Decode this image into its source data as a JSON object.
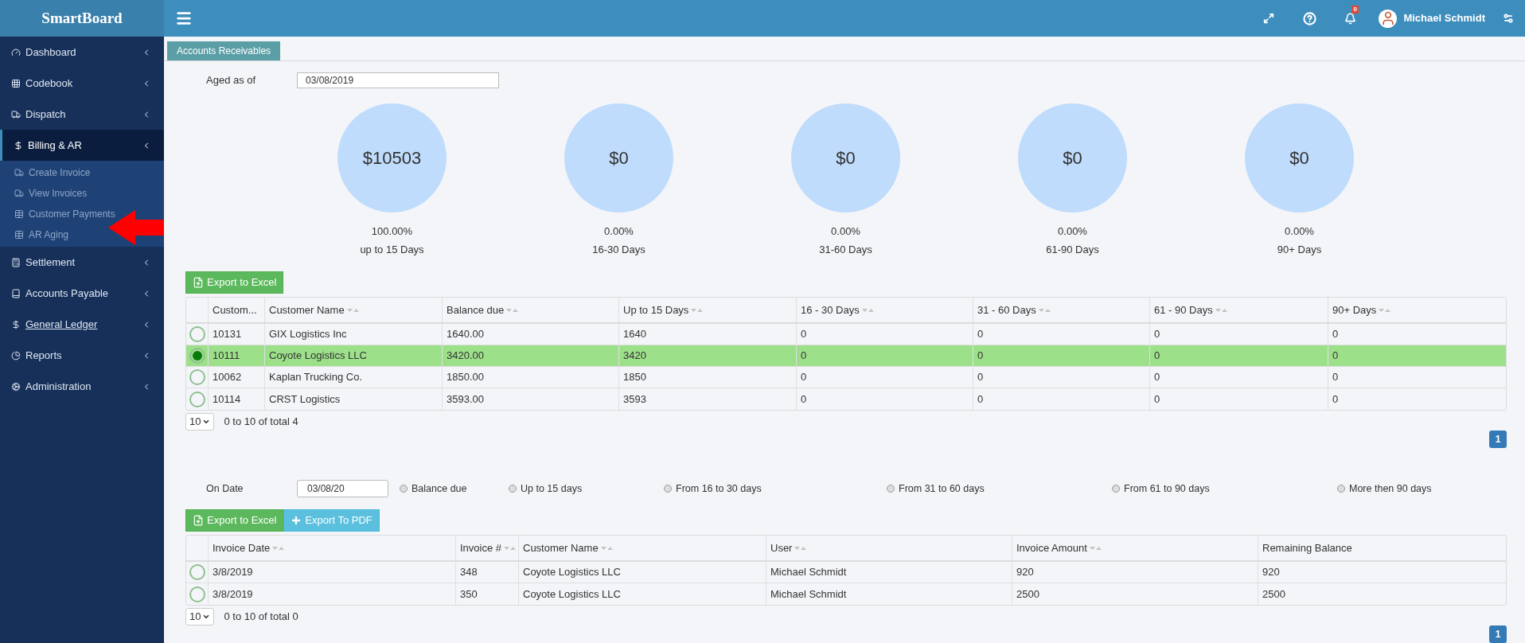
{
  "app": {
    "logo": "SmartBoard"
  },
  "header": {
    "user": "Michael Schmidt",
    "notifications": "0"
  },
  "sidebar": {
    "items": [
      {
        "label": "Dashboard",
        "expanded": false,
        "hovered": false
      },
      {
        "label": "Codebook",
        "expanded": false,
        "hovered": false
      },
      {
        "label": "Dispatch",
        "expanded": false,
        "hovered": false
      },
      {
        "label": "Billing & AR",
        "expanded": true,
        "hovered": false,
        "children": [
          {
            "label": "Create Invoice"
          },
          {
            "label": "View Invoices"
          },
          {
            "label": "Customer Payments"
          },
          {
            "label": "AR Aging"
          }
        ]
      },
      {
        "label": "Settlement",
        "expanded": false,
        "hovered": false
      },
      {
        "label": "Accounts Payable",
        "expanded": false,
        "hovered": false
      },
      {
        "label": "General Ledger",
        "expanded": false,
        "hovered": true
      },
      {
        "label": "Reports",
        "expanded": false,
        "hovered": false
      },
      {
        "label": "Administration",
        "expanded": false,
        "hovered": false
      }
    ]
  },
  "tabs": [
    {
      "label": "Accounts Receivables",
      "selected": true
    }
  ],
  "aging": {
    "label": "Aged as of",
    "value": "03/08/2019",
    "buckets": [
      {
        "amount": "$10503",
        "percent": "100.00%",
        "label": "up to 15 Days"
      },
      {
        "amount": "$0",
        "percent": "0.00%",
        "label": "16-30 Days"
      },
      {
        "amount": "$0",
        "percent": "0.00%",
        "label": "31-60 Days"
      },
      {
        "amount": "$0",
        "percent": "0.00%",
        "label": "61-90 Days"
      },
      {
        "amount": "$0",
        "percent": "0.00%",
        "label": "90+ Days"
      }
    ]
  },
  "customers": {
    "export_buttons": [
      {
        "label": "Export to Excel",
        "kind": "excel"
      }
    ],
    "columns": [
      {
        "label": "Custom...",
        "sortable": false
      },
      {
        "label": "Customer Name",
        "sortable": true
      },
      {
        "label": "Balance due",
        "sortable": true
      },
      {
        "label": "Up to 15 Days",
        "sortable": true
      },
      {
        "label": "16 - 30 Days",
        "sortable": true
      },
      {
        "label": "31 - 60 Days",
        "sortable": true
      },
      {
        "label": "61 - 90 Days",
        "sortable": true
      },
      {
        "label": "90+ Days",
        "sortable": true
      }
    ],
    "rows": [
      {
        "selected": false,
        "cells": [
          "10131",
          "GIX Logistics Inc",
          "1640.00",
          "1640",
          "0",
          "0",
          "0",
          "0"
        ]
      },
      {
        "selected": true,
        "cells": [
          "10111",
          "Coyote Logistics LLC",
          "3420.00",
          "3420",
          "0",
          "0",
          "0",
          "0"
        ]
      },
      {
        "selected": false,
        "cells": [
          "10062",
          "Kaplan Trucking Co.",
          "1850.00",
          "1850",
          "0",
          "0",
          "0",
          "0"
        ]
      },
      {
        "selected": false,
        "cells": [
          "10114",
          "CRST Logistics",
          "3593.00",
          "3593",
          "0",
          "0",
          "0",
          "0"
        ]
      }
    ],
    "page_size": "10",
    "summary": "0 to 10 of total 4",
    "page": "1"
  },
  "invoices": {
    "date_label": "On Date",
    "date_value": "03/08/20",
    "filters": [
      {
        "label": "Balance due",
        "selected": false
      },
      {
        "label": "Up to 15 days",
        "selected": false
      },
      {
        "label": "From 16 to 30 days",
        "selected": false
      },
      {
        "label": "From 31 to 60 days",
        "selected": false
      },
      {
        "label": "From 61 to 90 days",
        "selected": false
      },
      {
        "label": "More then 90 days",
        "selected": false
      }
    ],
    "export_buttons": [
      {
        "label": "Export to Excel",
        "kind": "excel"
      },
      {
        "label": "Export To PDF",
        "kind": "pdf"
      }
    ],
    "columns": [
      {
        "label": "Invoice Date",
        "sortable": true
      },
      {
        "label": "Invoice #",
        "sortable": true
      },
      {
        "label": "Customer Name",
        "sortable": true
      },
      {
        "label": "User",
        "sortable": true
      },
      {
        "label": "Invoice Amount",
        "sortable": true
      },
      {
        "label": "Remaining Balance",
        "sortable": false
      }
    ],
    "rows": [
      {
        "selected": false,
        "cells": [
          "3/8/2019",
          "348",
          "Coyote Logistics LLC",
          "Michael Schmidt",
          "920",
          "920"
        ]
      },
      {
        "selected": false,
        "cells": [
          "3/8/2019",
          "350",
          "Coyote Logistics LLC",
          "Michael Schmidt",
          "2500",
          "2500"
        ]
      }
    ],
    "page_size": "10",
    "summary": "0 to 10 of total 0",
    "page": "1"
  }
}
